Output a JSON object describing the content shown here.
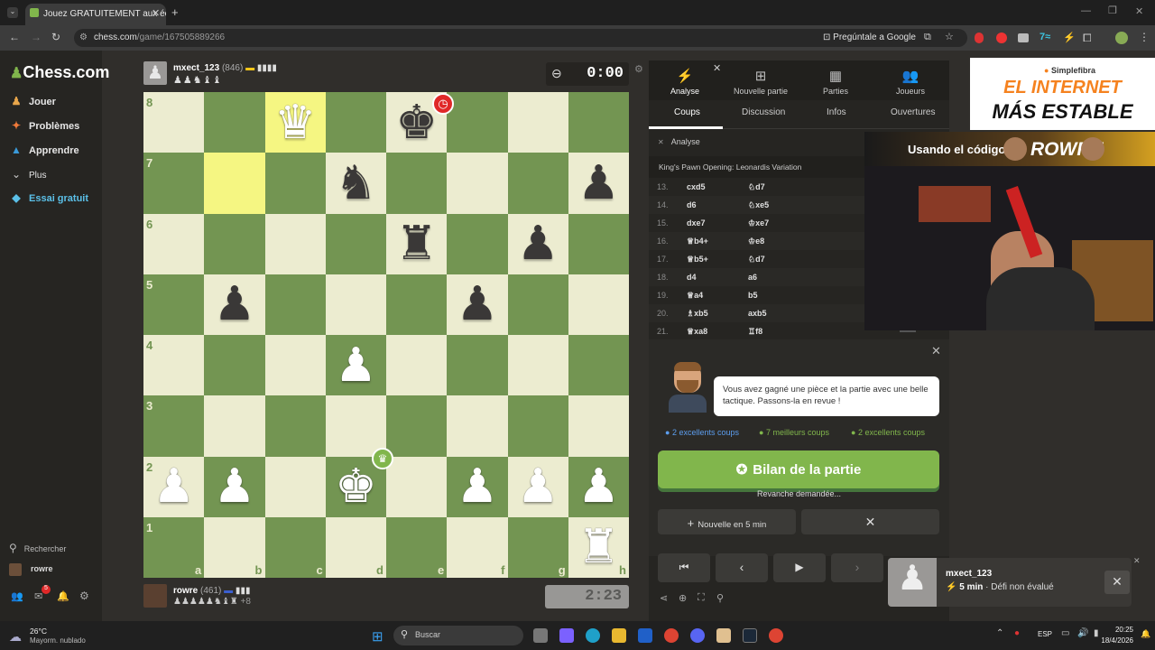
{
  "browser": {
    "tab_title": "Jouez GRATUITEMENT aux éch",
    "url_domain": "chess.com",
    "url_path": "/game/167505889266",
    "google_button": "Pregúntale a Google"
  },
  "sidebar": {
    "logo": "Chess.com",
    "items": [
      {
        "label": "Jouer",
        "icon": "pawn-play-icon"
      },
      {
        "label": "Problèmes",
        "icon": "puzzle-icon"
      },
      {
        "label": "Apprendre",
        "icon": "graduation-cap-icon"
      },
      {
        "label": "Plus",
        "icon": "chevron-down-icon"
      },
      {
        "label": "Essai gratuit",
        "icon": "diamond-icon"
      }
    ],
    "search_label": "Rechercher",
    "user_name": "rowre",
    "mail_badge": "5"
  },
  "opponent": {
    "name": "mxect_123",
    "rating": "(846)",
    "captured": "♟♟♞♝♝"
  },
  "player": {
    "name": "rowre",
    "rating": "(461)",
    "captured": "♟♟♟♟♟♞♝♜",
    "plus": "+8"
  },
  "clock": {
    "top": "0:00",
    "bottom": "2:23"
  },
  "board": {
    "files": [
      "a",
      "b",
      "c",
      "d",
      "e",
      "f",
      "g",
      "h"
    ],
    "ranks": [
      "8",
      "7",
      "6",
      "5",
      "4",
      "3",
      "2",
      "1"
    ],
    "pieces": [
      {
        "sq": "c8",
        "glyph": "♛",
        "color": "w"
      },
      {
        "sq": "e8",
        "glyph": "♚",
        "color": "b"
      },
      {
        "sq": "d7",
        "glyph": "♞",
        "color": "b"
      },
      {
        "sq": "h7",
        "glyph": "♟",
        "color": "b"
      },
      {
        "sq": "e6",
        "glyph": "♜",
        "color": "b"
      },
      {
        "sq": "g6",
        "glyph": "♟",
        "color": "b"
      },
      {
        "sq": "b5",
        "glyph": "♟",
        "color": "b"
      },
      {
        "sq": "f5",
        "glyph": "♟",
        "color": "b"
      },
      {
        "sq": "d4",
        "glyph": "♟",
        "color": "w"
      },
      {
        "sq": "a2",
        "glyph": "♟",
        "color": "w"
      },
      {
        "sq": "b2",
        "glyph": "♟",
        "color": "w"
      },
      {
        "sq": "d2",
        "glyph": "♚",
        "color": "w"
      },
      {
        "sq": "f2",
        "glyph": "♟",
        "color": "w"
      },
      {
        "sq": "g2",
        "glyph": "♟",
        "color": "w"
      },
      {
        "sq": "h2",
        "glyph": "♟",
        "color": "w"
      },
      {
        "sq": "h1",
        "glyph": "♜",
        "color": "w"
      }
    ],
    "highlights": [
      "c8",
      "b7"
    ],
    "colors": {
      "light": "#ececd0",
      "dark": "#739552",
      "hl_light": "#f5f682",
      "hl_dark": "#b9ca43"
    }
  },
  "panel": {
    "tabs": [
      {
        "label": "Analyse",
        "icon": "lightning-icon"
      },
      {
        "label": "Nouvelle partie",
        "icon": "plus-square-icon"
      },
      {
        "label": "Parties",
        "icon": "board-icon"
      },
      {
        "label": "Joueurs",
        "icon": "players-icon"
      }
    ],
    "subtabs": [
      "Coups",
      "Discussion",
      "Infos",
      "Ouvertures"
    ],
    "analysis_label": "Analyse",
    "opening": "King's Pawn Opening: Leonardis Variation",
    "moves": [
      {
        "n": "13.",
        "w": "cxd5",
        "b": "♘d7"
      },
      {
        "n": "14.",
        "w": "d6",
        "b": "♘xe5"
      },
      {
        "n": "15.",
        "w": "dxe7",
        "b": "♔xe7"
      },
      {
        "n": "16.",
        "w": "♕b4+",
        "b": "♔e8"
      },
      {
        "n": "17.",
        "w": "♕b5+",
        "b": "♘d7"
      },
      {
        "n": "18.",
        "w": "d4",
        "b": "a6"
      },
      {
        "n": "19.",
        "w": "♕a4",
        "b": "b5"
      },
      {
        "n": "20.",
        "w": "♗xb5",
        "b": "axb5"
      },
      {
        "n": "21.",
        "w": "♕xa8",
        "b": "♖f8"
      }
    ],
    "coach_message": "Vous avez gagné une pièce et la partie avec une belle tactique. Passons-la en revue !",
    "stats": [
      {
        "label": "2 excellents coups",
        "color": "#5c9ded"
      },
      {
        "label": "7 meilleurs coups",
        "color": "#81b64c"
      },
      {
        "label": "2 excellents coups",
        "color": "#81b64c"
      }
    ],
    "review_button": "Bilan de la partie",
    "rematch_text": "Revanche demandée...",
    "new_game_button": "Nouvelle en 5 min"
  },
  "ad": {
    "brand": "Simplefibra",
    "line1": "EL INTERNET",
    "line2": "MÁS ESTABLE",
    "promo": "Usando el código",
    "code": "ROWRE"
  },
  "notification": {
    "name": "mxect_123",
    "mode": "5 min",
    "desc": "· Défi non évalué"
  },
  "taskbar": {
    "temp": "26°C",
    "weather": "Mayorm. nublado",
    "search": "Buscar",
    "lang": "ESP",
    "time": "20:25",
    "date": "18/4/2026"
  }
}
